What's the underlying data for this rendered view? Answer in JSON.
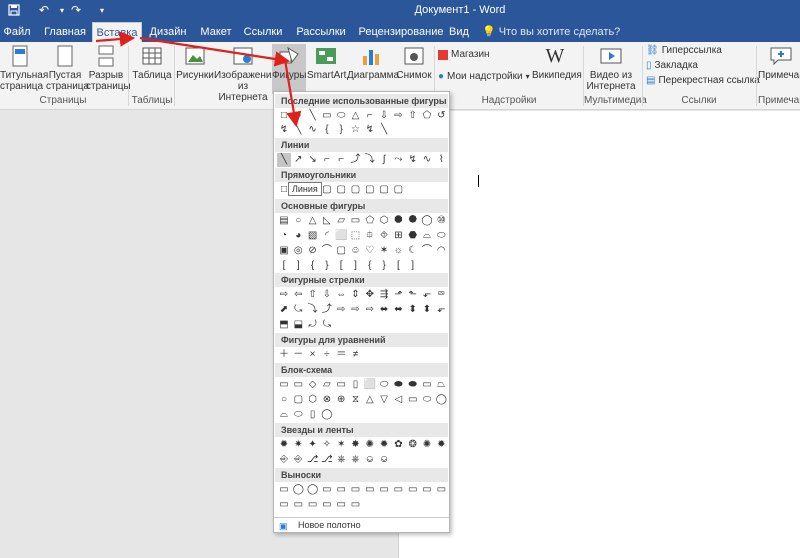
{
  "window": {
    "title": "Документ1 - Word"
  },
  "qat": {
    "save": "save-icon",
    "undo": "undo-icon",
    "redo": "redo-icon"
  },
  "tabs": [
    "Файл",
    "Главная",
    "Вставка",
    "Дизайн",
    "Макет",
    "Ссылки",
    "Рассылки",
    "Рецензирование",
    "Вид"
  ],
  "tell_me": "Что вы хотите сделать?",
  "ribbon": {
    "cover_page": "Титульная страница",
    "blank_page": "Пустая страница",
    "page_break": "Разрыв страницы",
    "pages_group": "Страницы",
    "table": "Таблица",
    "tables_group": "Таблицы",
    "pictures": "Рисунки",
    "online_pictures": "Изображения из Интернета",
    "shapes": "Фигуры",
    "smartart": "SmartArt",
    "chart": "Диаграмма",
    "screenshot": "Снимок",
    "store": "Магазин",
    "my_addins": "Мои надстройки",
    "wikipedia": "Википедия",
    "addins_group": "Надстройки",
    "online_video": "Видео из Интернета",
    "multimedia_group": "Мультимедиа",
    "hyperlink": "Гиперссылка",
    "bookmark": "Закладка",
    "cross_ref": "Перекрестная ссылка",
    "links_group": "Ссылки",
    "comment": "Примечан",
    "comments_group": "Примечан"
  },
  "shapes_menu": {
    "recent": "Последние использованные фигуры",
    "lines": "Линии",
    "rectangles": "Прямоугольники",
    "basic": "Основные фигуры",
    "block_arrows": "Фигурные стрелки",
    "equation": "Фигуры для уравнений",
    "flowchart": "Блок-схема",
    "stars": "Звезды и ленты",
    "callouts": "Выноски",
    "tooltip": "Линия",
    "new_canvas": "Новое полотно"
  },
  "colors": {
    "accent": "#2b579a",
    "arrow": "#e0201b"
  }
}
